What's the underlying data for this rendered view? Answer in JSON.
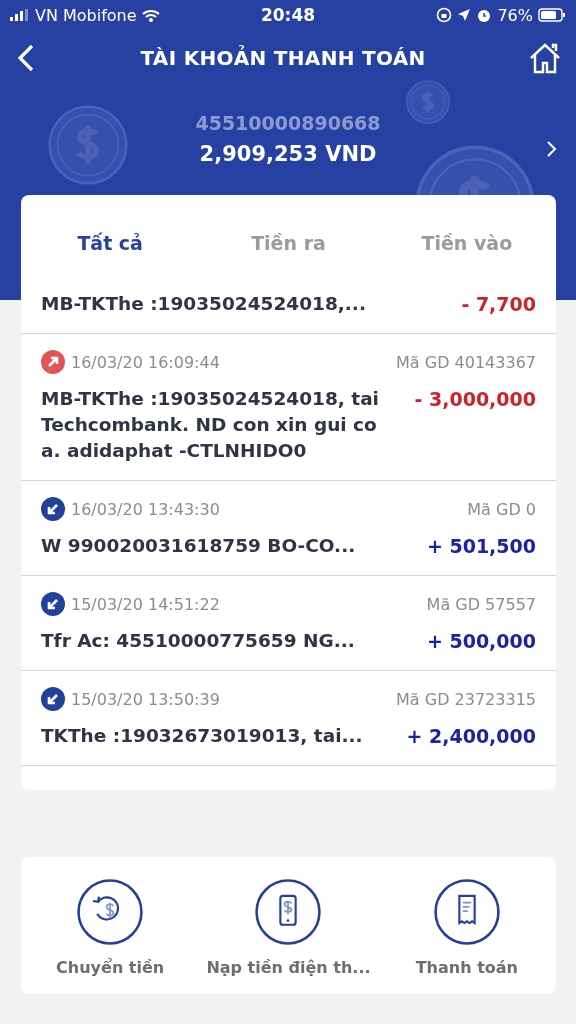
{
  "status_bar": {
    "carrier": "VN Mobifone",
    "time": "20:48",
    "battery": "76%"
  },
  "header": {
    "title": "TÀI KHOẢN THANH TOÁN",
    "account_number": "45510000890668",
    "balance": "2,909,253 VND"
  },
  "tabs": [
    {
      "label": "Tất cả",
      "selected": true
    },
    {
      "label": "Tiền ra",
      "selected": false
    },
    {
      "label": "Tiền vào",
      "selected": false
    }
  ],
  "transactions": [
    {
      "kind": "out",
      "description": "MB-TKThe :19035024524018,...",
      "amount": "- 7,700"
    },
    {
      "kind": "out",
      "datetime": "16/03/20 16:09:44",
      "code": "Mã GD 40143367",
      "description": "MB-TKThe :19035024524018, tai Techcombank. ND con xin gui co a. adidaphat -CTLNHIDO0",
      "amount": "- 3,000,000"
    },
    {
      "kind": "in",
      "datetime": "16/03/20 13:43:30",
      "code": "Mã GD 0",
      "description": "W 990020031618759 BO-CO...",
      "amount": "+ 501,500"
    },
    {
      "kind": "in",
      "datetime": "15/03/20 14:51:22",
      "code": "Mã GD 57557",
      "description": "Tfr Ac: 45510000775659 NG...",
      "amount": "+ 500,000"
    },
    {
      "kind": "in",
      "datetime": "15/03/20 13:50:39",
      "code": "Mã GD 23723315",
      "description": "TKThe :19032673019013, tai...",
      "amount": "+ 2,400,000"
    }
  ],
  "actions": [
    {
      "kind": "transfer",
      "label": "Chuyển tiền"
    },
    {
      "kind": "topup",
      "label": "Nạp tiền điện th..."
    },
    {
      "kind": "payment",
      "label": "Thanh toán"
    }
  ]
}
